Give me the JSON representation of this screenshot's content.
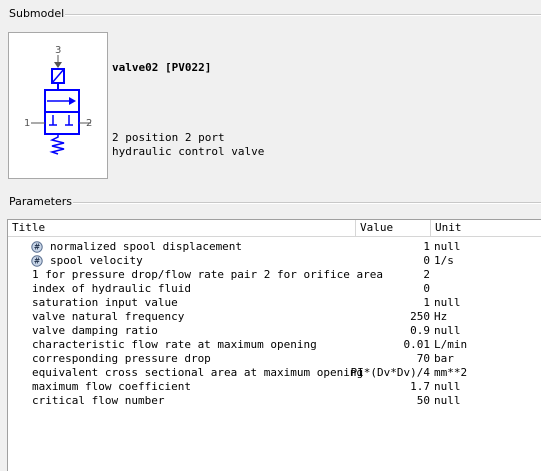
{
  "submodel": {
    "group_title": "Submodel",
    "name": "valve02 [PV022]",
    "description_line1": "2 position 2 port",
    "description_line2": "hydraulic control valve",
    "icon_ports": {
      "left": "1",
      "right": "2",
      "top": "3"
    }
  },
  "parameters": {
    "group_title": "Parameters",
    "columns": {
      "title": "Title",
      "value": "Value",
      "unit": "Unit"
    },
    "rows": [
      {
        "title": "normalized spool displacement",
        "value": "1",
        "unit": "null",
        "icon": "hash-icon"
      },
      {
        "title": "spool velocity",
        "value": "0",
        "unit": "1/s",
        "icon": "hash-icon"
      },
      {
        "title": "1 for pressure drop/flow rate pair 2 for orifice area",
        "value": "2",
        "unit": ""
      },
      {
        "title": "index of hydraulic fluid",
        "value": "0",
        "unit": ""
      },
      {
        "title": "saturation input value",
        "value": "1",
        "unit": "null"
      },
      {
        "title": "valve natural frequency",
        "value": "250",
        "unit": "Hz"
      },
      {
        "title": "valve damping ratio",
        "value": "0.9",
        "unit": "null"
      },
      {
        "title": "characteristic flow rate at maximum opening",
        "value": "0.01",
        "unit": "L/min"
      },
      {
        "title": "corresponding pressure drop",
        "value": "70",
        "unit": "bar"
      },
      {
        "title": "equivalent cross sectional area at maximum opening",
        "value": "PI*(Dv*Dv)/4",
        "unit": "mm**2"
      },
      {
        "title": "maximum flow coefficient",
        "value": "1.7",
        "unit": "null"
      },
      {
        "title": "critical flow number",
        "value": "50",
        "unit": "null"
      }
    ]
  }
}
